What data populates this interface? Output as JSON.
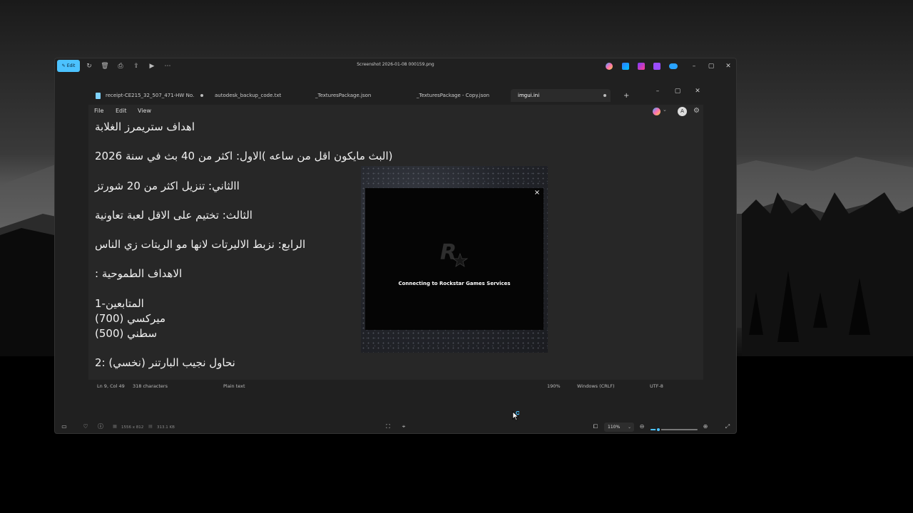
{
  "photos": {
    "title": "Screenshot 2026-01-08 000159.png",
    "edit_label": "Edit",
    "icons": [
      "rotate-icon",
      "delete-icon",
      "print-icon",
      "share-icon",
      "slideshow-icon",
      "more-icon"
    ],
    "app_icons": [
      "copilot-icon",
      "designer-icon",
      "clipchamp-icon",
      "onenote-icon",
      "onedrive-icon"
    ],
    "bottom": {
      "dimensions": "1556 x 812",
      "size": "313.1 KB",
      "zoom": "110%",
      "zoom_level": 0.17
    }
  },
  "notepad": {
    "tabs": [
      {
        "label": "receipt-CE215_32_507_471-HW No.",
        "modified": true
      },
      {
        "label": "autodesk_backup_code.txt",
        "modified": false
      },
      {
        "label": "_TexturesPackage.json",
        "modified": false
      },
      {
        "label": "_TexturesPackage - Copy.json",
        "modified": false
      },
      {
        "label": "imgui.ini",
        "modified": true,
        "active": true
      }
    ],
    "new_tab": "+",
    "menu": [
      "File",
      "Edit",
      "View"
    ],
    "lines": [
      "اهداف ستريمرز الغلابة",
      "(البث مايكون اقل من ساعه )الاول: اكثر من 40 بث في سنة 2026",
      "االثاني: تنزيل اكثر من 20 شورتز",
      "الثالث: تختيم على الاقل لعبة تعاونية",
      "الرابع: نزبط الاليرتات لانها مو الريتات زي الناس",
      "الاهداف الطموحية :",
      "المتابعين-1",
      "ميركسي (700)",
      "سطني (500)",
      "نحاول نجيب البارتنر (نخسي) :2"
    ],
    "status": {
      "position": "Ln 9, Col 49",
      "characters": "318 characters",
      "type": "Plain text",
      "zoom": "190%",
      "line_ending": "Windows (CRLF)",
      "encoding": "UTF-8"
    }
  },
  "rockstar": {
    "message": "Connecting to Rockstar Games Services",
    "close": "×"
  },
  "colors": {
    "accent": "#4cc2ff",
    "window_bg": "#202020",
    "editor_bg": "#272727"
  }
}
